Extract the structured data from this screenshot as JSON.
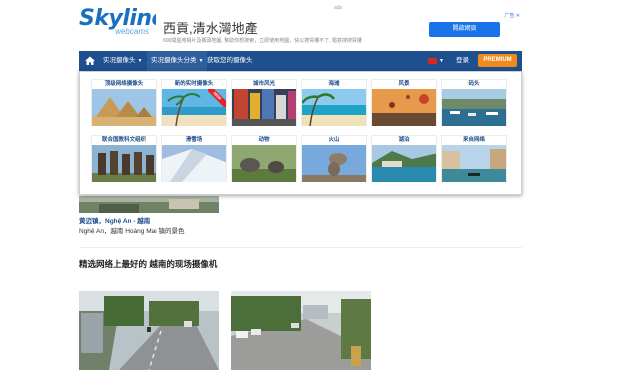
{
  "header": {
    "logo_main": "Skyline",
    "logo_sub": "webcams"
  },
  "ad": {
    "tag": "ads",
    "corner": "广告 ✕",
    "title": "西貢,清水灣地產",
    "desc": "600間屋苑相片及碼頭地圖, 幫助你想搜索，立即使用地圖，快以搜買樓不了, 隨意搜搜買樓",
    "button": "開啟網頁"
  },
  "nav": {
    "menu1": "实况摄像头",
    "menu2": "实况摄像头分类",
    "menu3": "获取您的摄像头",
    "login": "登录",
    "premium": "PREMIUM",
    "colors": {
      "bar": "#1e4f8e",
      "premium": "#f08a1e",
      "new": "#e3242b"
    }
  },
  "categories": [
    {
      "label": "顶级网络摄像头",
      "image": "pyramids"
    },
    {
      "label": "新的实时摄像头",
      "image": "beach-palm",
      "badge": "NEW"
    },
    {
      "label": "城市风光",
      "image": "city-times-square"
    },
    {
      "label": "海滩",
      "image": "tropical-beach"
    },
    {
      "label": "风景",
      "image": "hot-air-balloons"
    },
    {
      "label": "码头",
      "image": "harbor"
    },
    {
      "label": "联合国教科文组织",
      "image": "moai-statues"
    },
    {
      "label": "滑雪场",
      "image": "ski-slope"
    },
    {
      "label": "动物",
      "image": "elephants"
    },
    {
      "label": "火山",
      "image": "volcano-rock"
    },
    {
      "label": "湖泊",
      "image": "lake-town"
    },
    {
      "label": "来自网络",
      "image": "canal-city"
    }
  ],
  "page": {
    "cam_title": "黄迈镇，Nghệ An - 越南",
    "cam_desc": "Nghệ An，越南 Hoàng Mai 镇的景色",
    "section_title": "精选网络上最好的 越南的现场摄像机"
  }
}
